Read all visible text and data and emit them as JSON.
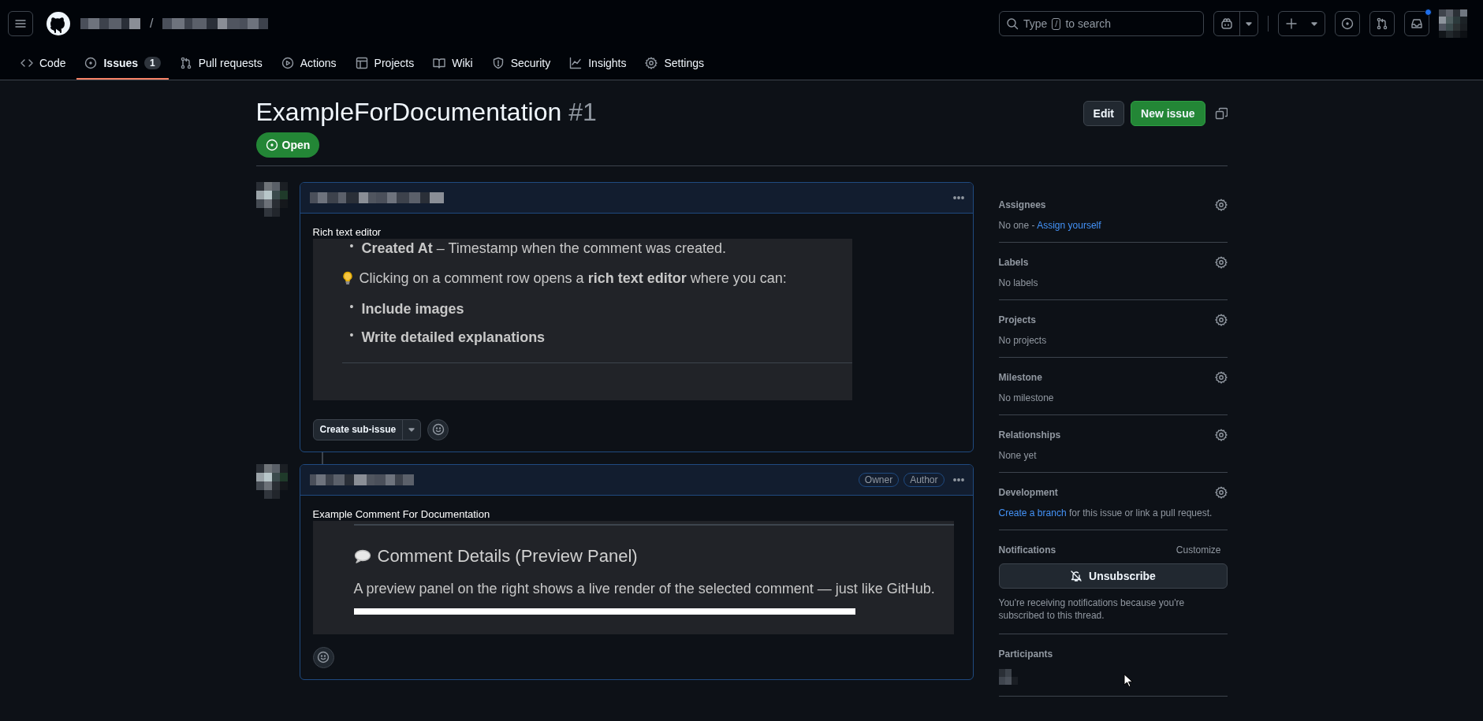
{
  "header": {
    "path_separator": "/",
    "search": {
      "before": "Type",
      "key": "/",
      "after": "to search"
    },
    "inbox_unread": true
  },
  "nav_tabs": [
    {
      "label": "Code",
      "selected": false
    },
    {
      "label": "Issues",
      "counter": "1",
      "selected": true
    },
    {
      "label": "Pull requests",
      "selected": false
    },
    {
      "label": "Actions",
      "selected": false
    },
    {
      "label": "Projects",
      "selected": false
    },
    {
      "label": "Wiki",
      "selected": false
    },
    {
      "label": "Security",
      "selected": false
    },
    {
      "label": "Insights",
      "selected": false
    },
    {
      "label": "Settings",
      "selected": false
    }
  ],
  "issue": {
    "title": "ExampleForDocumentation",
    "number": "#1",
    "state_label": "Open",
    "buttons": [
      {
        "label": "Edit",
        "kind": "default"
      },
      {
        "label": "New issue",
        "kind": "primary"
      }
    ]
  },
  "comments": [
    {
      "title": "Rich text editor",
      "footer_button": "Create sub-issue",
      "blocks": [
        {
          "kind": "list",
          "items": [
            {
              "marker": "•",
              "text": "**Created At** – Timestamp when the comment was created."
            }
          ]
        },
        {
          "kind": "tip",
          "text": "Clicking on a comment row opens a **rich text editor** where you can:"
        },
        {
          "kind": "list",
          "items": [
            {
              "marker": "•",
              "text": "**Include images**"
            },
            {
              "marker": "•",
              "text": "**Write detailed explanations**"
            }
          ]
        },
        {
          "kind": "rule"
        }
      ]
    },
    {
      "badges": [
        "Owner",
        "Author"
      ],
      "title": "Example Comment For Documentation",
      "blocks": [
        {
          "kind": "rule"
        },
        {
          "kind": "heading",
          "text": "Comment Details (Preview Panel)"
        },
        {
          "kind": "para",
          "text": "A preview panel on the right shows a live render of the selected comment — just like GitHub."
        },
        {
          "kind": "strip"
        }
      ]
    }
  ],
  "sidebar": [
    {
      "heading": "Assignees",
      "body": [
        {
          "text": "No one - ",
          "link": false
        },
        {
          "text": "Assign yourself",
          "link": true
        }
      ]
    },
    {
      "heading": "Labels",
      "body": [
        {
          "text": "No labels",
          "link": false
        }
      ]
    },
    {
      "heading": "Projects",
      "body": [
        {
          "text": "No projects",
          "link": false
        }
      ]
    },
    {
      "heading": "Milestone",
      "body": [
        {
          "text": "No milestone",
          "link": false
        }
      ]
    },
    {
      "heading": "Relationships",
      "body": [
        {
          "text": "None yet",
          "link": false
        }
      ]
    },
    {
      "heading": "Development",
      "body": [
        {
          "text": "Create a branch",
          "link": true
        },
        {
          "text": " for this issue or link a pull request.",
          "link": false
        }
      ]
    }
  ],
  "notifications": {
    "heading": "Notifications",
    "action": "Customize",
    "button": "Unsubscribe",
    "note": "You're receiving notifications because you're subscribed to this thread."
  },
  "participants": {
    "heading": "Participants"
  }
}
